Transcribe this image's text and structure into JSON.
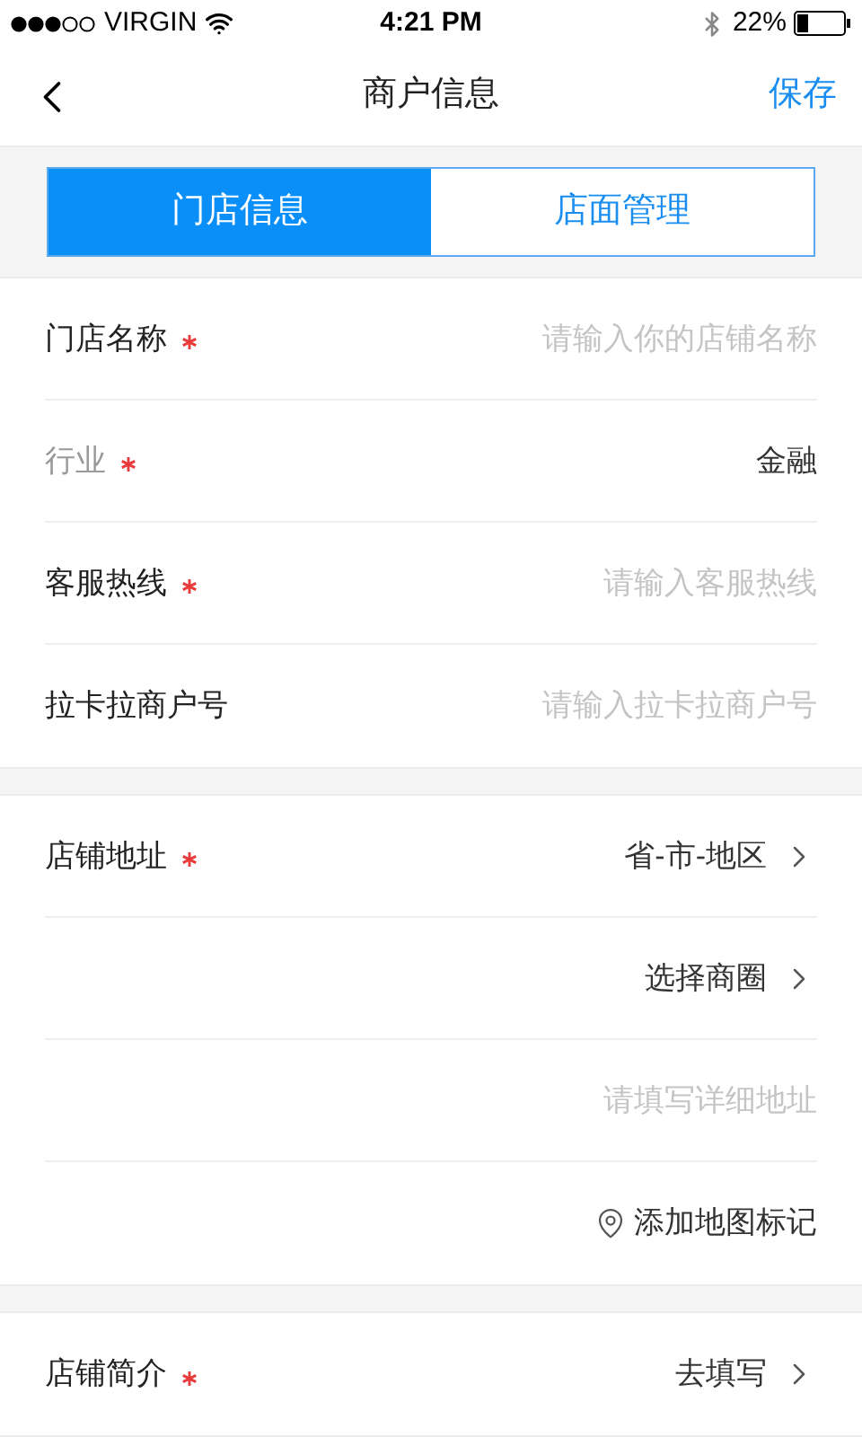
{
  "status_bar": {
    "carrier": "VIRGIN",
    "time": "4:21 PM",
    "battery": "22%"
  },
  "nav": {
    "title": "商户信息",
    "action": "保存"
  },
  "tabs": [
    {
      "label": "门店信息",
      "selected": true
    },
    {
      "label": "店面管理",
      "selected": false
    }
  ],
  "sections": [
    {
      "rows": [
        {
          "kind": "input",
          "label": "门店名称",
          "required": true,
          "disabled": false,
          "placeholder": "请输入你的店铺名称"
        },
        {
          "kind": "value",
          "label": "行业",
          "required": true,
          "disabled": true,
          "value": "金融"
        },
        {
          "kind": "input",
          "label": "客服热线",
          "required": true,
          "disabled": false,
          "placeholder": "请输入客服热线"
        },
        {
          "kind": "input",
          "label": "拉卡拉商户号",
          "required": false,
          "disabled": false,
          "placeholder": "请输入拉卡拉商户号"
        }
      ]
    },
    {
      "rows": [
        {
          "kind": "select",
          "label": "店铺地址",
          "required": true,
          "disabled": false,
          "value": "省-市-地区"
        },
        {
          "kind": "select",
          "value": "选择商圈"
        },
        {
          "kind": "input",
          "placeholder": "请填写详细地址"
        },
        {
          "kind": "map",
          "value": "添加地图标记"
        }
      ]
    },
    {
      "rows": [
        {
          "kind": "select",
          "label": "店铺简介",
          "required": true,
          "disabled": false,
          "value": "去填写"
        }
      ]
    }
  ]
}
